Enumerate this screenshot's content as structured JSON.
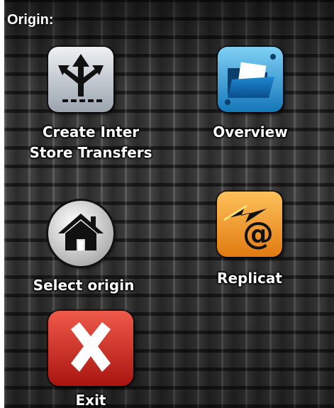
{
  "screen": {
    "title": "Origin:"
  },
  "menu": {
    "create_inter_store_transfers": {
      "line1": "Create Inter",
      "line2": "Store Transfers",
      "icon": "split-arrows-icon"
    },
    "overview": {
      "label": "Overview",
      "icon": "folder-icon"
    },
    "select_origin": {
      "label": "Select origin",
      "icon": "home-icon"
    },
    "replicat": {
      "label": "Replicat",
      "icon": "email-at-icon"
    },
    "exit": {
      "label": "Exit",
      "icon": "close-x-icon"
    }
  },
  "colors": {
    "transfer_tile": "#b9c2cc",
    "overview_tile": "#2a9fd6",
    "select_origin_tile": "#d9d9d9",
    "replicat_tile": "#f39a22",
    "exit_tile": "#d3231b"
  }
}
